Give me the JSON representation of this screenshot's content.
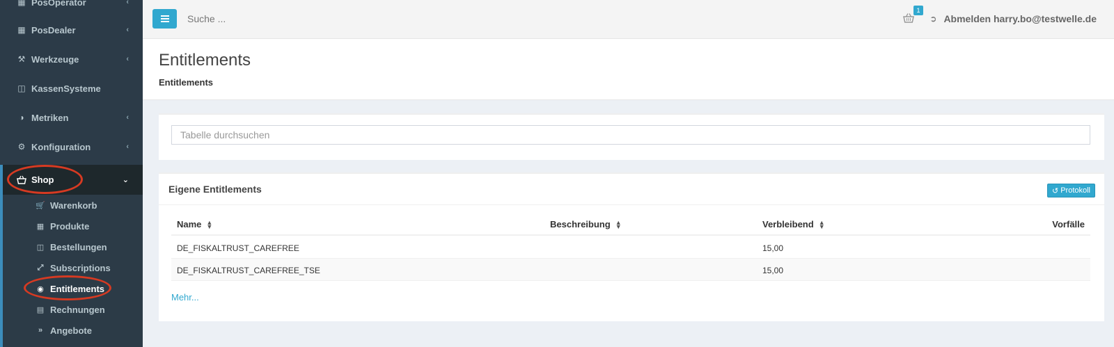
{
  "sidebar": {
    "items": [
      {
        "label": "PosOperator"
      },
      {
        "label": "PosDealer"
      },
      {
        "label": "Werkzeuge"
      },
      {
        "label": "KassenSysteme"
      },
      {
        "label": "Metriken"
      },
      {
        "label": "Konfiguration"
      },
      {
        "label": "Shop"
      }
    ],
    "subitems": [
      {
        "label": "Warenkorb"
      },
      {
        "label": "Produkte"
      },
      {
        "label": "Bestellungen"
      },
      {
        "label": "Subscriptions"
      },
      {
        "label": "Entitlements"
      },
      {
        "label": "Rechnungen"
      },
      {
        "label": "Angebote"
      }
    ]
  },
  "topbar": {
    "search_placeholder": "Suche ...",
    "cart_count": "1",
    "logout_label": "Abmelden harry.bo@testwelle.de"
  },
  "header": {
    "title": "Entitlements",
    "breadcrumb": "Entitlements"
  },
  "search_box": {
    "placeholder": "Tabelle durchsuchen"
  },
  "list": {
    "title": "Eigene Entitlements",
    "protokoll_label": "Protokoll",
    "columns": [
      "Name",
      "Beschreibung",
      "Verbleibend",
      "Vorfälle"
    ],
    "rows": [
      {
        "name": "DE_FISKALTRUST_CAREFREE",
        "description": "",
        "remaining": "15,00",
        "incidents": ""
      },
      {
        "name": "DE_FISKALTRUST_CAREFREE_TSE",
        "description": "",
        "remaining": "15,00",
        "incidents": ""
      }
    ],
    "more_label": "Mehr..."
  },
  "colors": {
    "sidebar_bg": "#2c3b48",
    "accent": "#31a8cf",
    "annotation_red": "#d63a22"
  }
}
